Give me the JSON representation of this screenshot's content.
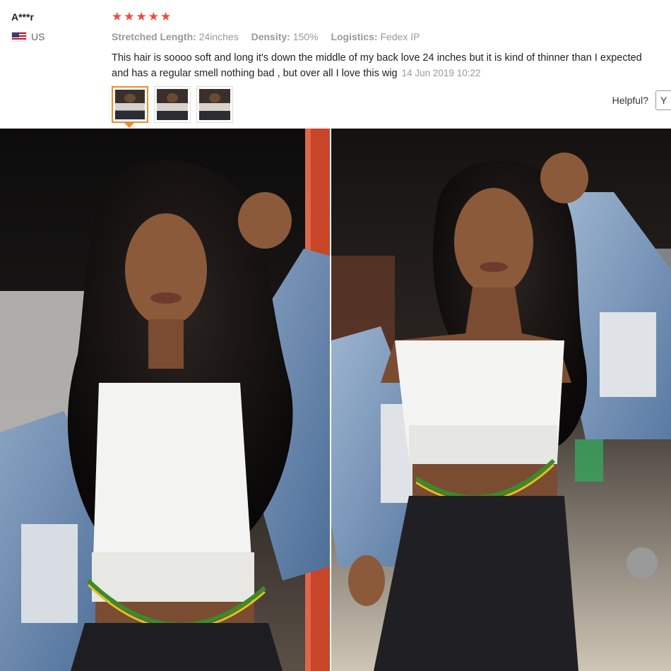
{
  "review": {
    "reviewer": "A***r",
    "country": "US",
    "rating_stars": 5,
    "stars_text": "★★★★★",
    "stretched_length_label": "Stretched Length:",
    "stretched_length_value": "24inches",
    "density_label": "Density:",
    "density_value": "150%",
    "logistics_label": "Logistics:",
    "logistics_value": "Fedex IP",
    "text_line1": "This hair is soooo soft and long it's down the middle of my back love 24 inches but it is kind of thinner than I expected",
    "text_line2": "and has a regular smell nothing bad , but over all I love this wig",
    "date": "14 Jun 2019 10:22",
    "thumbnails": [
      {
        "selected": true
      },
      {
        "selected": false
      },
      {
        "selected": false
      }
    ],
    "helpful_label": "Helpful?",
    "helpful_button": "Y"
  },
  "photos": {
    "left": {
      "icon": "customer-photo-1"
    },
    "right": {
      "icon": "customer-photo-2"
    }
  },
  "colors": {
    "star": "#f04a3a",
    "thumb_selected": "#f08c28",
    "muted_text": "#999999"
  }
}
